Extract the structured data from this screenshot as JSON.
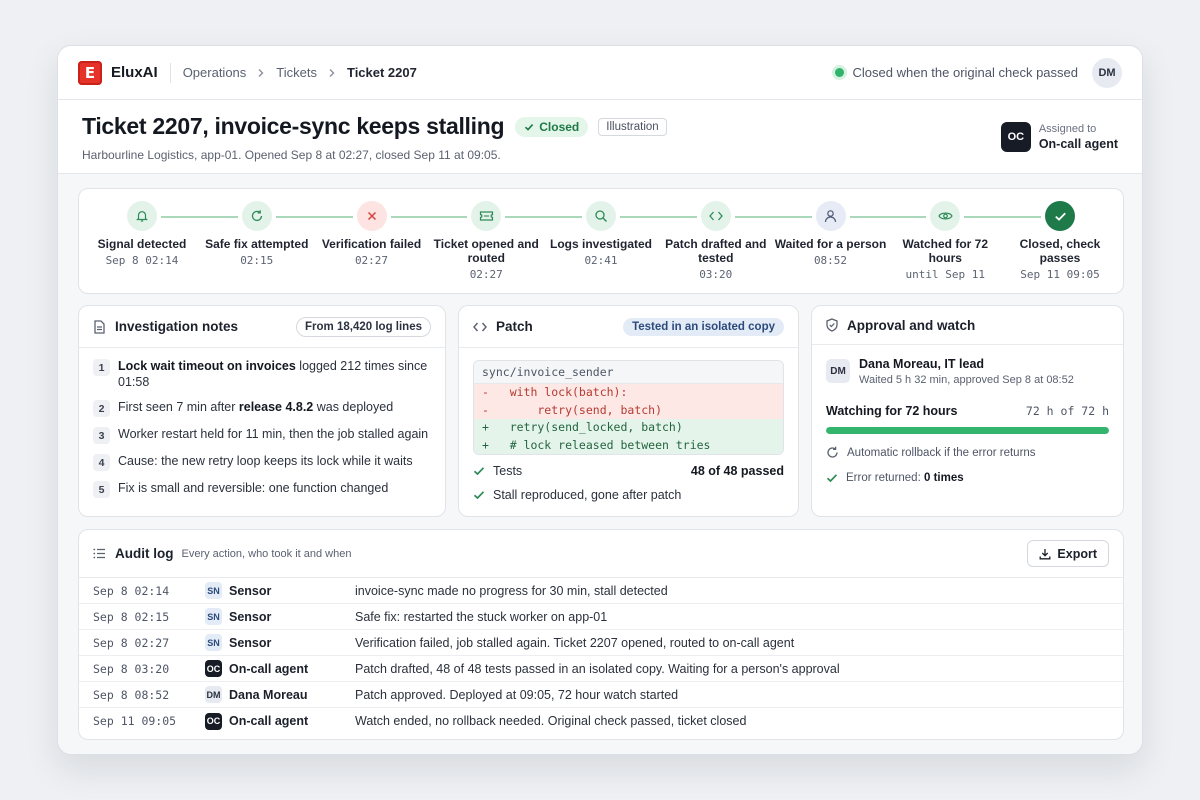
{
  "topbar": {
    "logo_letter": "E",
    "brand": "EluxAI",
    "breadcrumb": [
      "Operations",
      "Tickets",
      "Ticket 2207"
    ],
    "status_text": "Closed when the original check passed",
    "user_initials": "DM"
  },
  "header": {
    "title": "Ticket 2207, invoice-sync keeps stalling",
    "status_badge": "Closed",
    "tag": "Illustration",
    "subtitle": "Harbourline Logistics, app-01. Opened Sep 8 at 02:27, closed Sep 11 at 09:05.",
    "assignee_label": "Assigned to",
    "assignee_name": "On-call agent",
    "assignee_initials": "OC"
  },
  "timeline": [
    {
      "label": "Signal detected",
      "time": "Sep 8 02:14",
      "icon": "bell-icon",
      "state": "ok"
    },
    {
      "label": "Safe fix attempted",
      "time": "02:15",
      "icon": "refresh-icon",
      "state": "ok"
    },
    {
      "label": "Verification failed",
      "time": "02:27",
      "icon": "x-icon",
      "state": "fail"
    },
    {
      "label": "Ticket opened and routed",
      "time": "02:27",
      "icon": "ticket-icon",
      "state": "ok"
    },
    {
      "label": "Logs investigated",
      "time": "02:41",
      "icon": "search-icon",
      "state": "ok"
    },
    {
      "label": "Patch drafted and tested",
      "time": "03:20",
      "icon": "code-icon",
      "state": "ok"
    },
    {
      "label": "Waited for a person",
      "time": "08:52",
      "icon": "person-icon",
      "state": "person"
    },
    {
      "label": "Watched for 72 hours",
      "time": "until Sep 11",
      "icon": "eye-icon",
      "state": "ok"
    },
    {
      "label": "Closed, check passes",
      "time": "Sep 11 09:05",
      "icon": "check-icon",
      "state": "done"
    }
  ],
  "notes": {
    "title": "Investigation notes",
    "source_pill": "From 18,420 log lines",
    "items": [
      {
        "num": "1",
        "bold": "Lock wait timeout on invoices",
        "pre": "",
        "post": " logged 212 times since 01:58"
      },
      {
        "num": "2",
        "pre": "First seen 7 min after ",
        "bold": "release 4.8.2",
        "post": " was deployed"
      },
      {
        "num": "3",
        "pre": "Worker restart held for 11 min, then the job stalled again",
        "bold": "",
        "post": ""
      },
      {
        "num": "4",
        "pre": "Cause: the new retry loop keeps its lock while it waits",
        "bold": "",
        "post": ""
      },
      {
        "num": "5",
        "pre": "Fix is small and reversible: one function changed",
        "bold": "",
        "post": ""
      }
    ]
  },
  "patch": {
    "title": "Patch",
    "env_pill": "Tested in an isolated copy",
    "file": "sync/invoice_sender",
    "lines": [
      {
        "type": "del",
        "text": "-   with lock(batch):"
      },
      {
        "type": "del",
        "text": "-       retry(send, batch)"
      },
      {
        "type": "add",
        "text": "+   retry(send_locked, batch)"
      },
      {
        "type": "add",
        "text": "+   # lock released between tries"
      }
    ],
    "tests_label": "Tests",
    "tests_value": "48 of 48 passed",
    "repro_label": "Stall reproduced, gone after patch"
  },
  "approval": {
    "title": "Approval and watch",
    "approver_initials": "DM",
    "approver_name": "Dana Moreau, IT lead",
    "approver_sub": "Waited 5 h 32 min, approved Sep 8 at 08:52",
    "watch_label": "Watching for 72 hours",
    "watch_value": "72 h of 72 h",
    "watch_progress": 1.0,
    "rollback_text": "Automatic rollback if the error returns",
    "error_label": "Error returned: ",
    "error_value": "0 times"
  },
  "audit": {
    "title": "Audit log",
    "subtitle": "Every action, who took it and when",
    "export_label": "Export",
    "rows": [
      {
        "time": "Sep 8 02:14",
        "tag": "SN",
        "tag_type": "sn",
        "actor": "Sensor",
        "msg": "invoice-sync made no progress for 30 min, stall detected"
      },
      {
        "time": "Sep 8 02:15",
        "tag": "SN",
        "tag_type": "sn",
        "actor": "Sensor",
        "msg": "Safe fix: restarted the stuck worker on app-01"
      },
      {
        "time": "Sep 8 02:27",
        "tag": "SN",
        "tag_type": "sn",
        "actor": "Sensor",
        "msg": "Verification failed, job stalled again. Ticket 2207 opened, routed to on-call agent"
      },
      {
        "time": "Sep 8 03:20",
        "tag": "OC",
        "tag_type": "oc",
        "actor": "On-call agent",
        "msg": "Patch drafted, 48 of 48 tests passed in an isolated copy. Waiting for a person's approval"
      },
      {
        "time": "Sep 8 08:52",
        "tag": "DM",
        "tag_type": "dm",
        "actor": "Dana Moreau",
        "msg": "Patch approved. Deployed at 09:05, 72 hour watch started"
      },
      {
        "time": "Sep 11 09:05",
        "tag": "OC",
        "tag_type": "oc",
        "actor": "On-call agent",
        "msg": "Watch ended, no rollback needed. Original check passed, ticket closed"
      }
    ]
  },
  "colors": {
    "accent_green": "#30b36b",
    "brand_red": "#e6332a",
    "fail_red": "#d4443a",
    "dark": "#161b26"
  }
}
